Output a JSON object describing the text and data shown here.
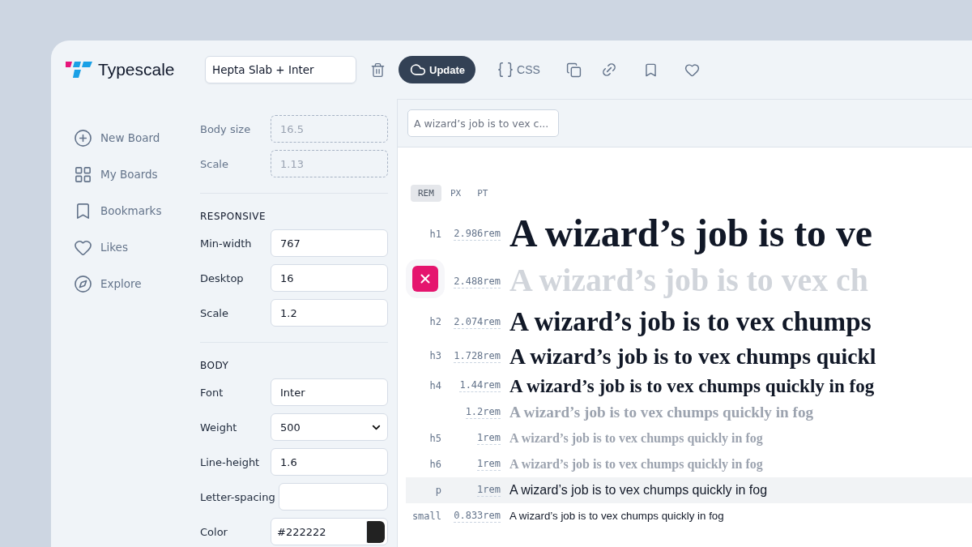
{
  "brand": {
    "name": "Typescale"
  },
  "toolbar": {
    "board_name": "Hepta Slab + Inter",
    "update_label": "Update",
    "css_label": "CSS"
  },
  "nav": [
    {
      "label": "New Board"
    },
    {
      "label": "My Boards"
    },
    {
      "label": "Bookmarks"
    },
    {
      "label": "Likes"
    },
    {
      "label": "Explore"
    }
  ],
  "settings": [
    {
      "fields": [
        {
          "label": "Body size",
          "kind": "text",
          "placeholder": "16.5",
          "disabled": true
        },
        {
          "label": "Scale",
          "kind": "text",
          "placeholder": "1.13",
          "disabled": true
        }
      ]
    },
    {
      "heading": "RESPONSIVE",
      "fields": [
        {
          "label": "Min-width",
          "kind": "text",
          "value": "767",
          "disabled": false
        },
        {
          "label": "Desktop",
          "kind": "text",
          "value": "16",
          "disabled": false
        },
        {
          "label": "Scale",
          "kind": "text",
          "value": "1.2",
          "disabled": false
        }
      ]
    },
    {
      "heading": "BODY",
      "fields": [
        {
          "label": "Font",
          "kind": "text",
          "value": "Inter",
          "disabled": false
        },
        {
          "label": "Weight",
          "kind": "select",
          "value": "500",
          "disabled": false
        },
        {
          "label": "Line-height",
          "kind": "text",
          "value": "1.6",
          "disabled": false
        },
        {
          "label": "Letter-spacing",
          "kind": "text",
          "disabled": false
        },
        {
          "label": "Color",
          "kind": "color",
          "value": "#222222",
          "color": "#222222",
          "disabled": false
        }
      ]
    }
  ],
  "preview": {
    "sample_text": "A wizard’s job is to vex c...",
    "units": [
      {
        "label": "REM",
        "selected": true
      },
      {
        "label": "PX",
        "selected": false
      },
      {
        "label": "PT",
        "selected": false
      }
    ],
    "rows": [
      {
        "tag": "h1",
        "size": "2.986rem",
        "kind": "heading",
        "color": "#111827",
        "text": "A wizard’s job is to ve",
        "selected": false,
        "removable": false
      },
      {
        "size": "2.488rem",
        "kind": "heading",
        "color": "#d1d5db",
        "text": "A wizard’s job is to vex ch",
        "selected": false,
        "removable": true
      },
      {
        "tag": "h2",
        "size": "2.074rem",
        "kind": "heading",
        "color": "#111827",
        "text": "A wizard’s job is to vex chumps",
        "selected": false,
        "removable": false
      },
      {
        "tag": "h3",
        "size": "1.728rem",
        "kind": "heading",
        "color": "#111827",
        "text": "A wizard’s job is to vex chumps quickl",
        "selected": false,
        "removable": false
      },
      {
        "tag": "h4",
        "size": "1.44rem",
        "kind": "heading",
        "color": "#111827",
        "text": "A wizard’s job is to vex chumps quickly in fog",
        "selected": false,
        "removable": false
      },
      {
        "size": "1.2rem",
        "kind": "heading",
        "color": "#9ca3af",
        "text": "A wizard’s job is to vex chumps quickly in fog",
        "selected": false,
        "removable": false
      },
      {
        "tag": "h5",
        "size": "1rem",
        "kind": "heading",
        "color": "#9ca3af",
        "text": "A wizard’s job is to vex chumps quickly in fog",
        "selected": false,
        "removable": false
      },
      {
        "tag": "h6",
        "size": "1rem",
        "kind": "heading",
        "color": "#9ca3af",
        "text": "A wizard’s job is to vex chumps quickly in fog",
        "selected": false,
        "removable": false
      },
      {
        "tag": "p",
        "size": "1rem",
        "kind": "body",
        "color": "#111827",
        "text": "A wizard’s job is to vex chumps quickly in fog",
        "selected": true,
        "removable": false
      },
      {
        "tag": "small",
        "size": "0.833rem",
        "kind": "body",
        "color": "#111827",
        "text": "A wizard’s job is to vex chumps quickly in fog",
        "selected": false,
        "removable": false
      }
    ]
  }
}
